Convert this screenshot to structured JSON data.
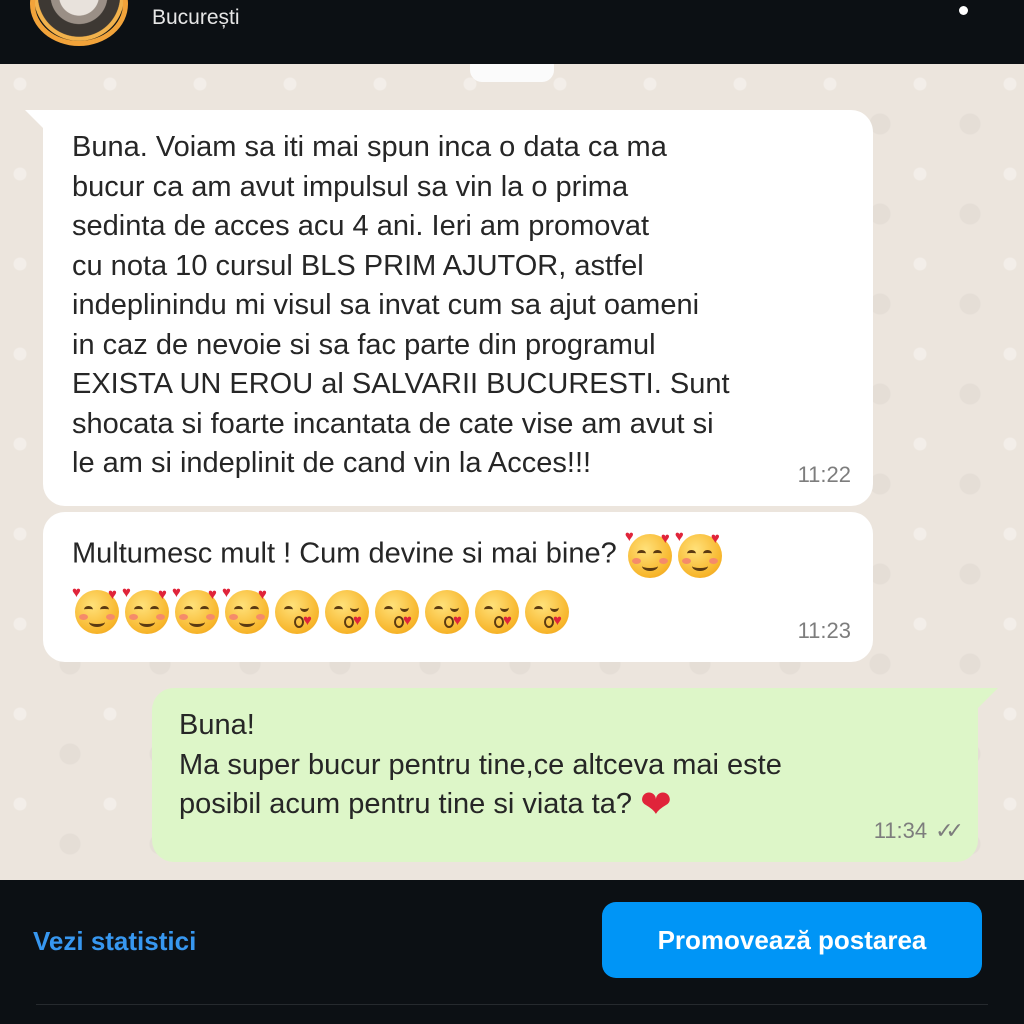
{
  "header": {
    "location": "București"
  },
  "messages": [
    {
      "id": "msg1",
      "direction": "incoming",
      "text": "Buna. Voiam sa iti mai spun inca o data ca  ma\nbucur ca am avut impulsul sa vin la o prima\nsedinta de acces acu 4 ani. Ieri am promovat\ncu nota 10  cursul BLS PRIM AJUTOR, astfel\nindeplinindu mi visul sa invat cum sa ajut oameni\nin caz de nevoie si sa fac parte din programul\nEXISTA UN EROU  al SALVARII BUCURESTI.  Sunt\nshocata si foarte incantata de cate vise am avut si\nle am si indeplinit de cand vin la Acces!!!",
      "time": "11:22"
    },
    {
      "id": "msg2",
      "direction": "incoming",
      "text": "Multumesc mult !   Cum devine si mai bine?",
      "emoji_inline": [
        "smiling-face-with-hearts",
        "smiling-face-with-hearts"
      ],
      "emoji_row": [
        "smiling-face-with-hearts",
        "smiling-face-with-hearts",
        "smiling-face-with-hearts",
        "smiling-face-with-hearts",
        "face-blowing-a-kiss",
        "face-blowing-a-kiss",
        "face-blowing-a-kiss",
        "face-blowing-a-kiss",
        "face-blowing-a-kiss",
        "face-blowing-a-kiss"
      ],
      "time": "11:23"
    },
    {
      "id": "msg3",
      "direction": "outgoing",
      "text": "Buna!\nMa super bucur pentru tine,ce altceva mai este\nposibil acum pentru tine si viata ta?",
      "trailing_emoji": "red-heart",
      "time": "11:34",
      "status_icon": "double-check-icon"
    }
  ],
  "footer": {
    "stats_label": "Vezi statistici",
    "promote_label": "Promovează postarea"
  },
  "colors": {
    "accent_link": "#3797f0",
    "button_bg": "#0095f6",
    "incoming_bubble": "#ffffff",
    "outgoing_bubble": "#ddf6c8",
    "background": "#0c1014"
  }
}
